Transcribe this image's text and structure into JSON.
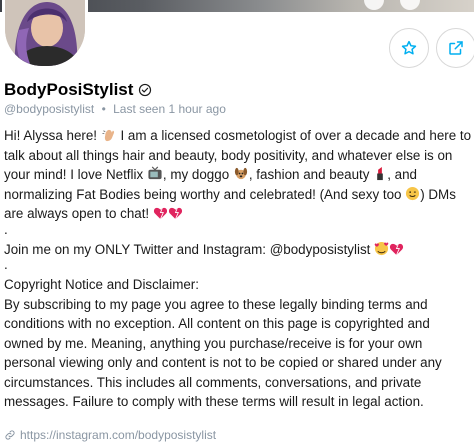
{
  "profile": {
    "display_name": "BodyPosiStylist",
    "handle": "@bodyposistylist",
    "separator": "•",
    "last_seen": "Last seen 1 hour ago"
  },
  "actions": {
    "favorite_icon": "star-icon",
    "share_icon": "share-icon"
  },
  "bio": {
    "p1_part1": "Hi! Alyssa here! ",
    "p1_part2": " I am a licensed cosmetologist of over a decade and here to talk about all things hair and beauty, body positivity, and whatever else is on your mind! I love Netflix ",
    "p1_part3": ", my doggo ",
    "p1_part4": ", fashion and beauty ",
    "p1_part5": ", and normalizing Fat Bodies being worthy and celebrated! (And sexy too ",
    "p1_part6": ") DMs are always open to chat! ",
    "dot1": ".",
    "p2": "Join me on my ONLY Twitter and Instagram: @bodyposistylist ",
    "dot2": ".",
    "p3_title": "Copyright Notice and Disclaimer:",
    "p3_body": "By subscribing to my page you agree to these legally binding terms and conditions with no exception. All content on this page is copyrighted and owned by me. Meaning, anything you purchase/receive is for your own personal viewing only and content is not to be copied or shared under any circumstances. This includes all comments, conversations, and private messages. Failure to comply with these terms will result in legal action."
  },
  "link": {
    "url": "https://instagram.com/bodyposistylist"
  },
  "colors": {
    "accent": "#00aff0",
    "muted": "#8a96a3",
    "heart": "#e0245e"
  }
}
